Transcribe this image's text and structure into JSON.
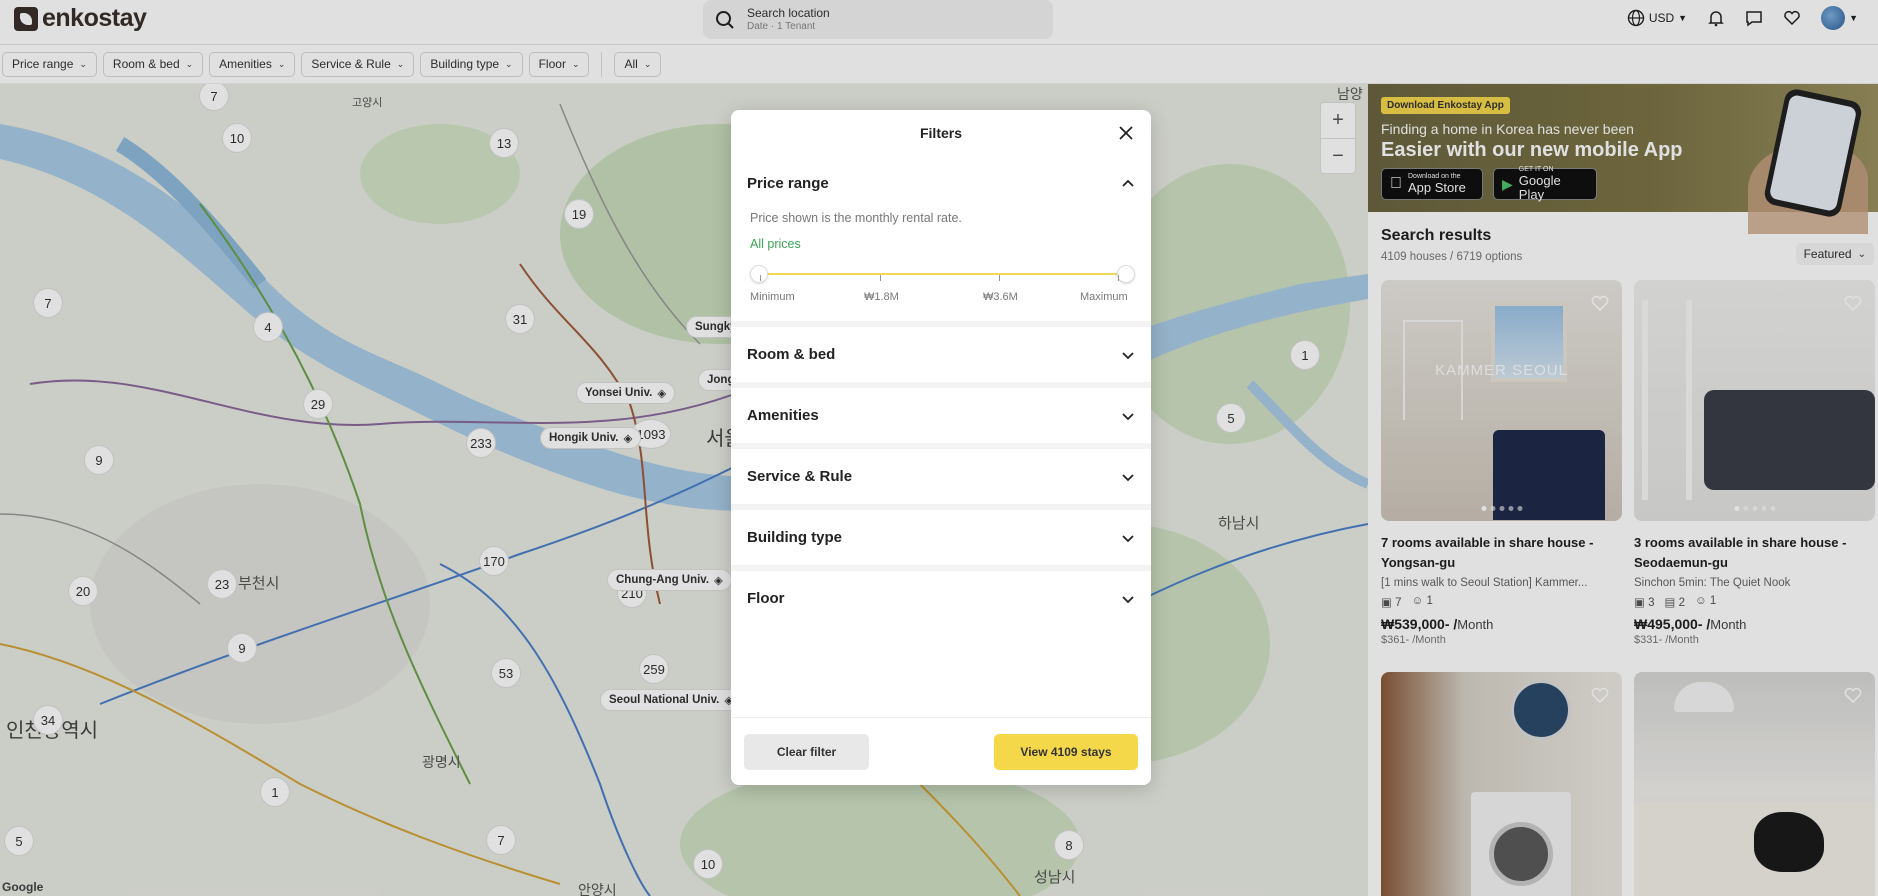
{
  "header": {
    "logo_text": "enkostay",
    "search_title": "Search location",
    "search_sub": "Date · 1 Tenant",
    "currency": "USD"
  },
  "filter_chips": [
    "Price range",
    "Room & bed",
    "Amenities",
    "Service & Rule",
    "Building type",
    "Floor",
    "All"
  ],
  "map": {
    "zoom_in": "+",
    "zoom_out": "−",
    "clusters": [
      "7",
      "10",
      "13",
      "19",
      "7",
      "4",
      "31",
      "29",
      "9",
      "233",
      "1093",
      "170",
      "23",
      "20",
      "9",
      "210",
      "259",
      "53",
      "34",
      "1",
      "7",
      "10",
      "5",
      "1",
      "5",
      "8"
    ],
    "universities": [
      "Yonsei Univ.",
      "Hongik Univ.",
      "Chung-Ang Univ.",
      "Seoul National Univ.",
      "Sungky",
      "Jong"
    ],
    "labels": [
      "고양시",
      "부천시",
      "인천광역시",
      "광명시",
      "하남시",
      "서울",
      "성남시",
      "안양시",
      "남양"
    ],
    "attribution": "Google"
  },
  "banner": {
    "badge": "Download Enkostay App",
    "line1": "Finding a home in Korea has never been",
    "line2": "Easier with our new mobile App",
    "appstore_small": "Download on the",
    "appstore_big": "App Store",
    "gplay_small": "GET IT ON",
    "gplay_big": "Google Play"
  },
  "results": {
    "title": "Search results",
    "count": "4109 houses / 6719 options",
    "sort": "Featured"
  },
  "listings": [
    {
      "photo_text": "KAMMER SEOUL",
      "title": "7 rooms available in share house - Yongsan-gu",
      "subtitle": "[1 mins walk to Seoul Station] Kammer...",
      "rooms": "7",
      "people": "1",
      "price": "₩539,000- /",
      "price_unit": "Month",
      "usd": "$361- /Month"
    },
    {
      "photo_text": "",
      "title": "3 rooms available in share house - Seodaemun-gu",
      "subtitle": "Sinchon 5min: The Quiet Nook",
      "rooms": "3",
      "baths": "2",
      "people": "1",
      "price": "₩495,000- /",
      "price_unit": "Month",
      "usd": "$331- /Month"
    },
    {
      "photo_text": ""
    },
    {
      "photo_text": ""
    }
  ],
  "modal": {
    "title": "Filters",
    "sections": [
      "Price range",
      "Room & bed",
      "Amenities",
      "Service & Rule",
      "Building type",
      "Floor"
    ],
    "price_note": "Price shown is the monthly rental rate.",
    "price_all": "All prices",
    "tick_labels": [
      "Minimum",
      "₩1.8M",
      "₩3.6M",
      "Maximum"
    ],
    "clear_label": "Clear filter",
    "view_label": "View 4109 stays"
  },
  "colors": {
    "accent_yellow": "#f5d84a",
    "green_text": "#3aa655",
    "brand_dark": "#3a2f2a"
  }
}
